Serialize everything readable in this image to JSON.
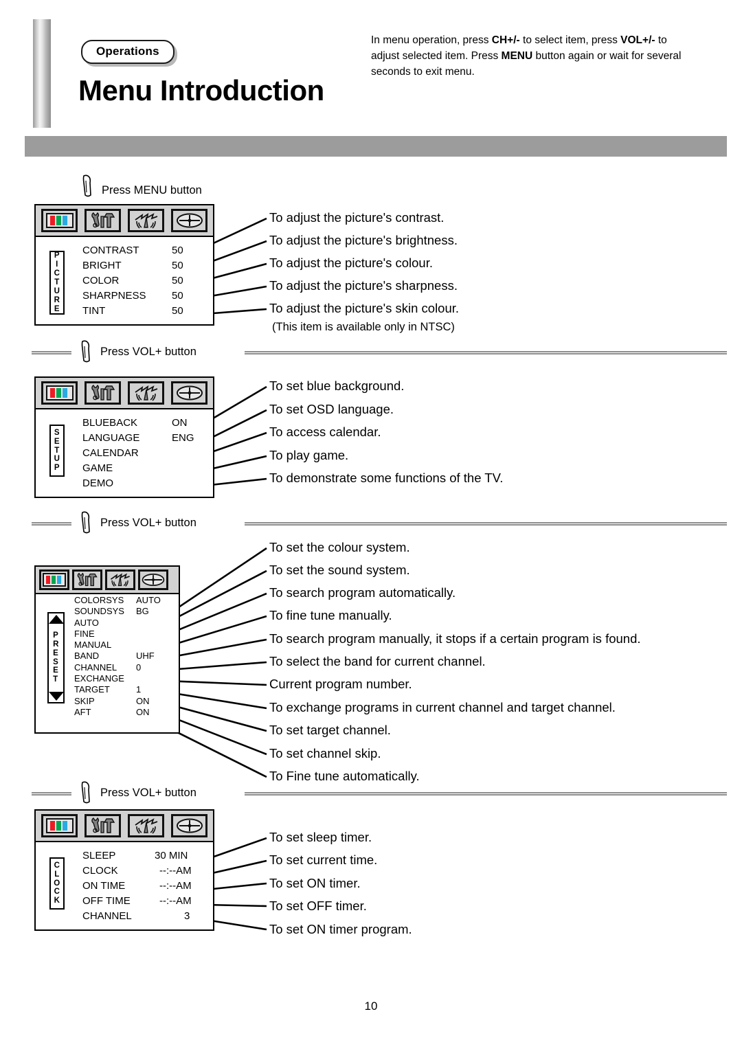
{
  "header": {
    "section_tag": "Operations",
    "title": "Menu Introduction",
    "intro_parts": {
      "p1": "In menu operation, press ",
      "b1": "CH+/-",
      "p2": " to select item, press ",
      "b2": "VOL+/-",
      "p3": " to adjust selected item. Press ",
      "b3": "MENU",
      "p4": " button again or wait for several seconds to exit menu."
    }
  },
  "icon_row": {
    "picture_icon": "rgb-color-bars-icon",
    "setup_icon": "wrench-hammer-icon",
    "preset_icon": "antenna-tuning-icon",
    "clock_icon": "crosshair-oval-icon"
  },
  "steps": {
    "step1_label": "Press MENU button",
    "step2_label": "Press VOL+ button",
    "step3_label": "Press VOL+ button",
    "step4_label": "Press VOL+ button"
  },
  "menus": [
    {
      "id": "picture",
      "vlabel": "PICTURE",
      "rows": [
        {
          "key": "CONTRAST",
          "value": "50"
        },
        {
          "key": "BRIGHT",
          "value": "50"
        },
        {
          "key": "COLOR",
          "value": "50"
        },
        {
          "key": "SHARPNESS",
          "value": "50"
        },
        {
          "key": "TINT",
          "value": "50"
        }
      ],
      "descriptions": [
        "To  adjust the picture's contrast.",
        "To adjust the picture's brightness.",
        "To adjust the picture's colour.",
        "To adjust the picture's sharpness.",
        "To adjust the picture's skin colour."
      ],
      "description_note": "(This item is available only in NTSC)"
    },
    {
      "id": "setup",
      "vlabel": "SETUP",
      "rows": [
        {
          "key": "BLUEBACK",
          "value": "ON"
        },
        {
          "key": "LANGUAGE",
          "value": "ENG"
        },
        {
          "key": "CALENDAR",
          "value": ""
        },
        {
          "key": "GAME",
          "value": ""
        },
        {
          "key": "DEMO",
          "value": ""
        }
      ],
      "descriptions": [
        "To  set blue background.",
        "To set OSD language.",
        "To access calendar.",
        "To play game.",
        "To demonstrate some functions of the TV."
      ]
    },
    {
      "id": "preset",
      "vlabel": "PRESET",
      "rows": [
        {
          "key": "COLORSYS",
          "value": "AUTO"
        },
        {
          "key": "SOUNDSYS",
          "value": "BG"
        },
        {
          "key": "AUTO",
          "value": ""
        },
        {
          "key": "FINE",
          "value": ""
        },
        {
          "key": "MANUAL",
          "value": ""
        },
        {
          "key": "BAND",
          "value": "UHF"
        },
        {
          "key": "CHANNEL",
          "value": "0"
        },
        {
          "key": "EXCHANGE",
          "value": ""
        },
        {
          "key": "TARGET",
          "value": "1"
        },
        {
          "key": "SKIP",
          "value": "ON"
        },
        {
          "key": "AFT",
          "value": "ON"
        }
      ],
      "descriptions": [
        "To set the colour system.",
        "To set the sound system.",
        "To search program automatically.",
        "To fine tune manually.",
        "To search program manually, it stops if a certain program is found.",
        "To select the band for current channel.",
        "Current program number.",
        "To exchange programs in current channel and target channel.",
        "To set target channel.",
        "To  set channel skip.",
        "To Fine tune automatically."
      ]
    },
    {
      "id": "clock",
      "vlabel": "CLOCK",
      "rows": [
        {
          "key": "SLEEP",
          "value": "30 MIN"
        },
        {
          "key": "CLOCK",
          "value": "--:--AM"
        },
        {
          "key": "ON TIME",
          "value": "--:--AM"
        },
        {
          "key": "OFF TIME",
          "value": "--:--AM"
        },
        {
          "key": "CHANNEL",
          "value": "3"
        }
      ],
      "descriptions": [
        "To  set sleep timer.",
        "To set current time.",
        "To set ON timer.",
        "To set OFF timer.",
        "To set ON timer program."
      ]
    }
  ],
  "footer": {
    "page_number": "10"
  },
  "colors": {
    "ink": "#000000",
    "band_grey": "#9c9c9c",
    "osd_icon_bg": "#d2d2d2",
    "red": "#ee1c24",
    "green": "#00a651",
    "cyan": "#29abe2",
    "tool_grey": "#808080"
  }
}
